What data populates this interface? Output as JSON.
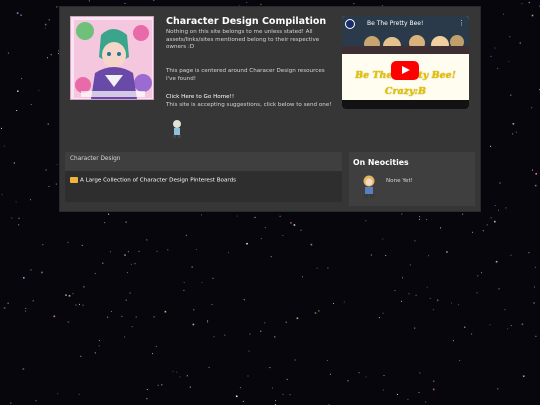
{
  "header": {
    "title": "Character Design Compilation",
    "description": "Nothing on this site belongs to me unless stated! All assets/links/sites mentioned belong to their respective owners :D",
    "purpose": "This page is centered around Characer Design resources I've found!",
    "home_link": "Click Here to Go Home!!",
    "suggestions": "This site is accepting suggestions, click below to send one!"
  },
  "video": {
    "title": "Be The Pretty Bee!",
    "banner_line1": "Be The Pretty Bee!",
    "banner_line2": "Crazy:B"
  },
  "character_design": {
    "heading": "Character Design",
    "links": [
      {
        "label": "A Large Collection of Character Design Pinterest Boards",
        "icon": "folder-icon"
      }
    ]
  },
  "neocities": {
    "heading": "On Neocities",
    "text": "None Yet!"
  },
  "colors": {
    "background": "#07060d",
    "panel": "#363636",
    "youtube_red": "#ff0000",
    "banner_yellow": "#e1c300"
  }
}
